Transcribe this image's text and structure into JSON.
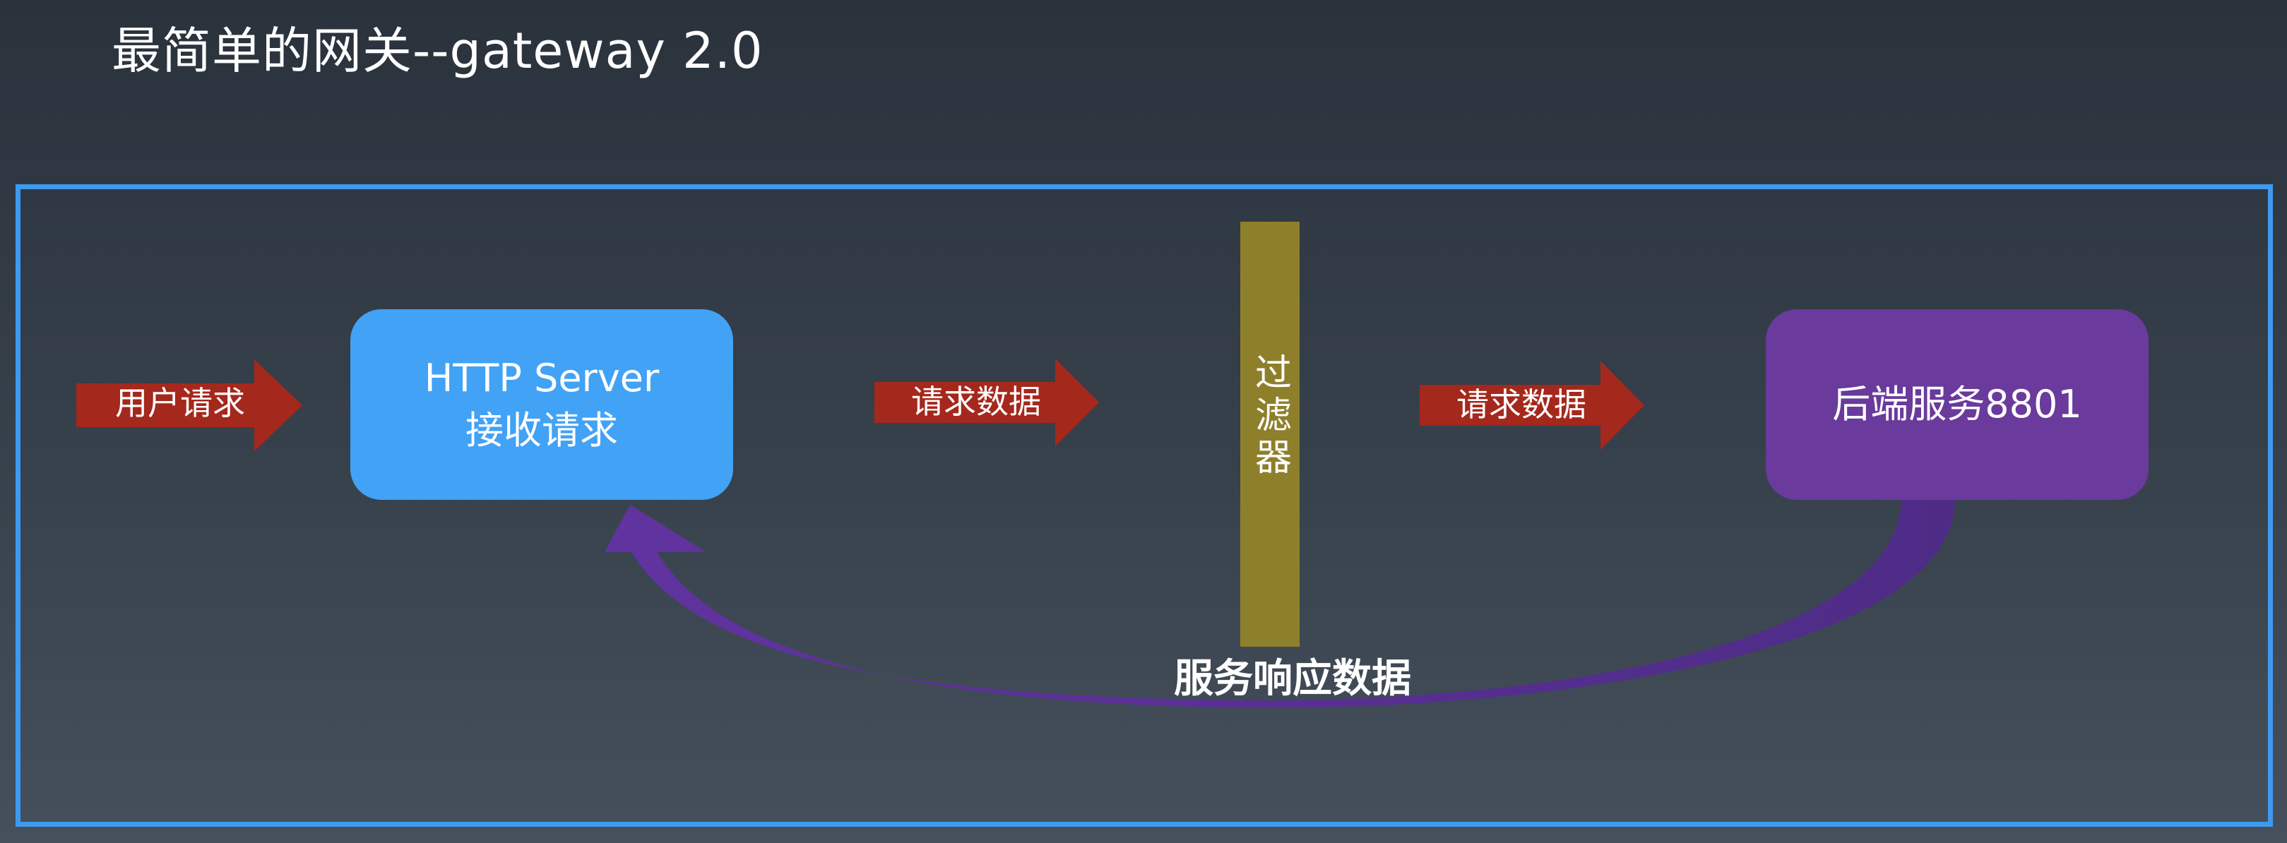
{
  "slide": {
    "title": "最简单的网关--gateway 2.0"
  },
  "diagram": {
    "arrows": {
      "user_request": "用户请求",
      "request_data_1": "请求数据",
      "request_data_2": "请求数据"
    },
    "http_server": {
      "line1": "HTTP Server",
      "line2": "接收请求"
    },
    "filter": {
      "label": "过滤器"
    },
    "backend": {
      "label": "后端服务8801"
    },
    "response": {
      "label": "服务响应数据"
    }
  },
  "colors": {
    "frame_border": "#3d9af0",
    "arrow_red": "#a5281c",
    "http_box": "#42a2f5",
    "backend_box": "#6a3a9c",
    "filter_bar": "#8e7f2b",
    "curve_arrow": "#5c2f96"
  }
}
